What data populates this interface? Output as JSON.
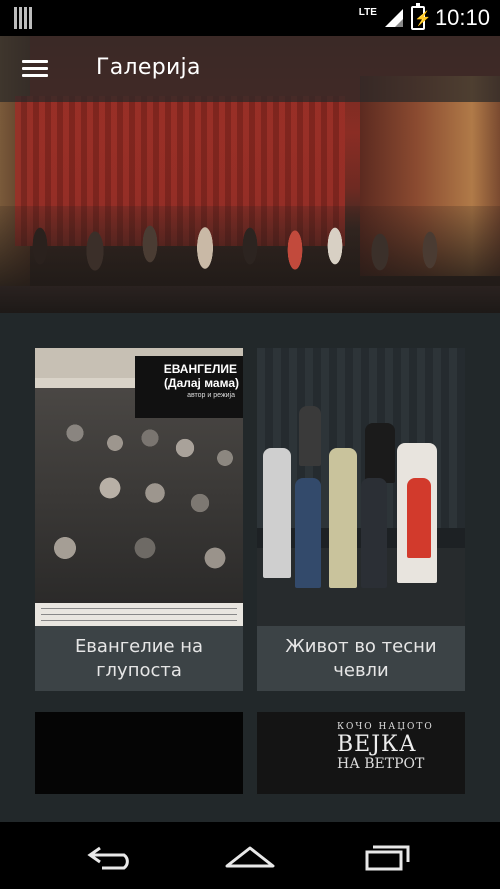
{
  "status_bar": {
    "network": "LTE",
    "time": "10:10",
    "icons": [
      "notification-bars-icon",
      "signal-icon",
      "battery-charging-icon"
    ]
  },
  "app_bar": {
    "title": "Галерија",
    "menu_icon": "hamburger-menu-icon"
  },
  "hero": {
    "description_icon": "theatre-stage-photo"
  },
  "gallery": {
    "items": [
      {
        "caption": "Евангелие на глупоста",
        "poster_title_line1": "ЕВАНГЕЛИЕ",
        "poster_title_line2": "(Далај мама)",
        "poster_subtitle": "автор и режија"
      },
      {
        "caption": "Живот во тесни чевли"
      },
      {
        "caption": ""
      },
      {
        "caption": "",
        "poster_line1": "КОЧО НАЏОТО",
        "poster_line2": "ВЕЈКА",
        "poster_line3": "НА ВЕТРОТ"
      }
    ]
  },
  "nav_bar": {
    "back_icon": "back-icon",
    "home_icon": "home-icon",
    "recents_icon": "recent-apps-icon"
  },
  "colors": {
    "app_bar": "#282828",
    "content_bg": "#22282a",
    "card_caption_bg": "#3c4346",
    "text": "#ffffff"
  }
}
